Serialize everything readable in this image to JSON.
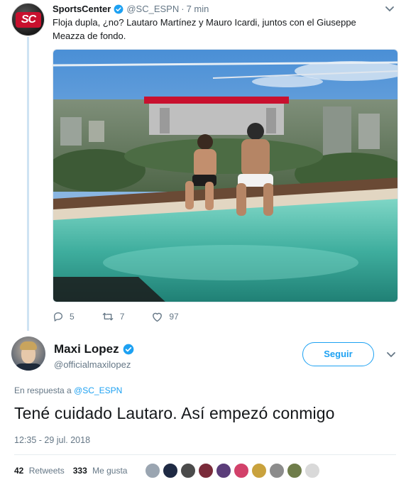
{
  "tweet": {
    "author_name": "SportsCenter",
    "author_handle": "@SC_ESPN",
    "time": "7 min",
    "avatar_text": "SC",
    "text": "Floja dupla, ¿no? Lautaro Martínez y Mauro Icardi, juntos con el Giuseppe Meazza de fondo.",
    "replies": "5",
    "retweets": "7",
    "likes": "97"
  },
  "reply": {
    "author_name": "Maxi Lopez",
    "author_handle": "@officialmaxilopez",
    "follow_label": "Seguir",
    "in_reply_prefix": "En respuesta a",
    "in_reply_mention": "@SC_ESPN",
    "text": "Tené cuidado Lautaro. Así empezó conmigo",
    "timestamp": "12:35 - 29 jul. 2018",
    "retweets_count": "42",
    "retweets_label": "Retweets",
    "likes_count": "333",
    "likes_label": "Me gusta"
  },
  "colors": {
    "accent": "#1da1f2",
    "secondary_text": "#657786",
    "brand_sc": "#c8102e"
  },
  "icons": [
    "verified-badge-icon",
    "chevron-down-icon",
    "reply-icon",
    "retweet-icon",
    "like-icon"
  ]
}
